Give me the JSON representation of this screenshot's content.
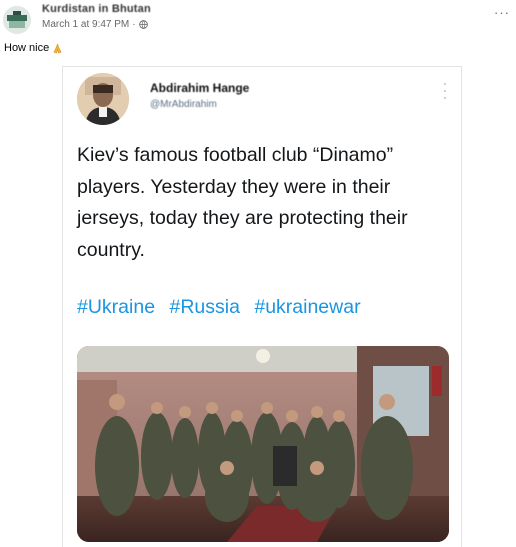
{
  "post": {
    "page_name": "Kurdistan in Bhutan",
    "date": "March 1 at 9:47 PM",
    "separator": "·",
    "caption": "How nice",
    "more_label": "···",
    "icons": {
      "avatar": "page-avatar-icon",
      "privacy": "globe-icon",
      "emoji": "pray-icon",
      "more": "more-options-icon"
    }
  },
  "tweet": {
    "author_name": "Abdirahim Hange",
    "author_handle": "@MrAbdirahim",
    "text": "Kiev’s famous football club “Dinamo” players. Yesterday they were in their jerseys, today they are protecting their country.",
    "hashtags": [
      "#Ukraine",
      "#Russia",
      "#ukrainewar"
    ],
    "hashtag_color": "#1b95e0",
    "media": {
      "description_icon": "photo-soldiers-image"
    }
  }
}
